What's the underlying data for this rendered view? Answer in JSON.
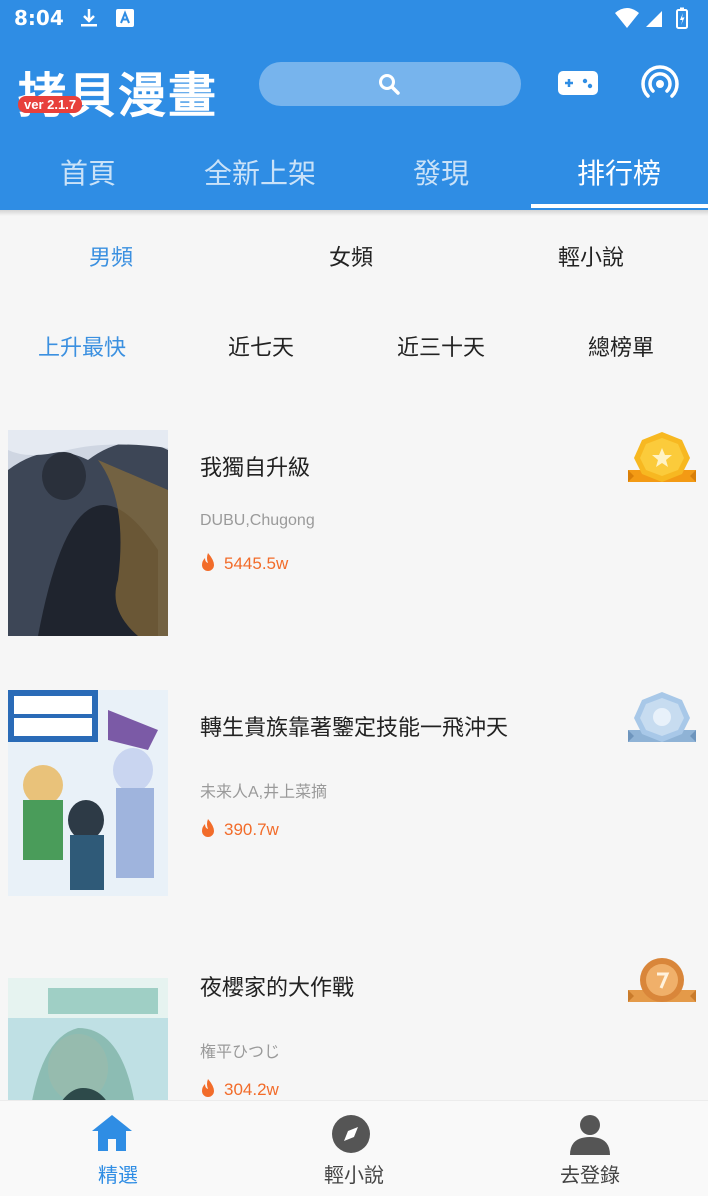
{
  "status_bar": {
    "time": "8:04"
  },
  "header": {
    "logo_text": "拷貝漫畫",
    "version_badge": "ver 2.1.7",
    "colors": {
      "primary": "#2f8de4",
      "accent": "#f26c2a",
      "badge": "#e8403b"
    }
  },
  "main_tabs": [
    {
      "label": "首頁"
    },
    {
      "label": "全新上架"
    },
    {
      "label": "發現"
    },
    {
      "label": "排行榜"
    }
  ],
  "category_tabs": [
    {
      "label": "男頻"
    },
    {
      "label": "女頻"
    },
    {
      "label": "輕小說"
    }
  ],
  "period_tabs": [
    {
      "label": "上升最快"
    },
    {
      "label": "近七天"
    },
    {
      "label": "近三十天"
    },
    {
      "label": "總榜單"
    }
  ],
  "rankings": [
    {
      "title": "我獨自升級",
      "author": "DUBU,Chugong",
      "popularity": "5445.5w",
      "medal": "gold"
    },
    {
      "title": "轉生貴族靠著鑒定技能一飛沖天",
      "author": "未来人A,井上菜摘",
      "popularity": "390.7w",
      "medal": "silver"
    },
    {
      "title": "夜櫻家的大作戰",
      "author": "権平ひつじ",
      "popularity": "304.2w",
      "medal": "bronze"
    }
  ],
  "bottom_nav": [
    {
      "label": "精選",
      "icon": "home-icon"
    },
    {
      "label": "輕小說",
      "icon": "compass-icon"
    },
    {
      "label": "去登錄",
      "icon": "user-icon"
    }
  ]
}
